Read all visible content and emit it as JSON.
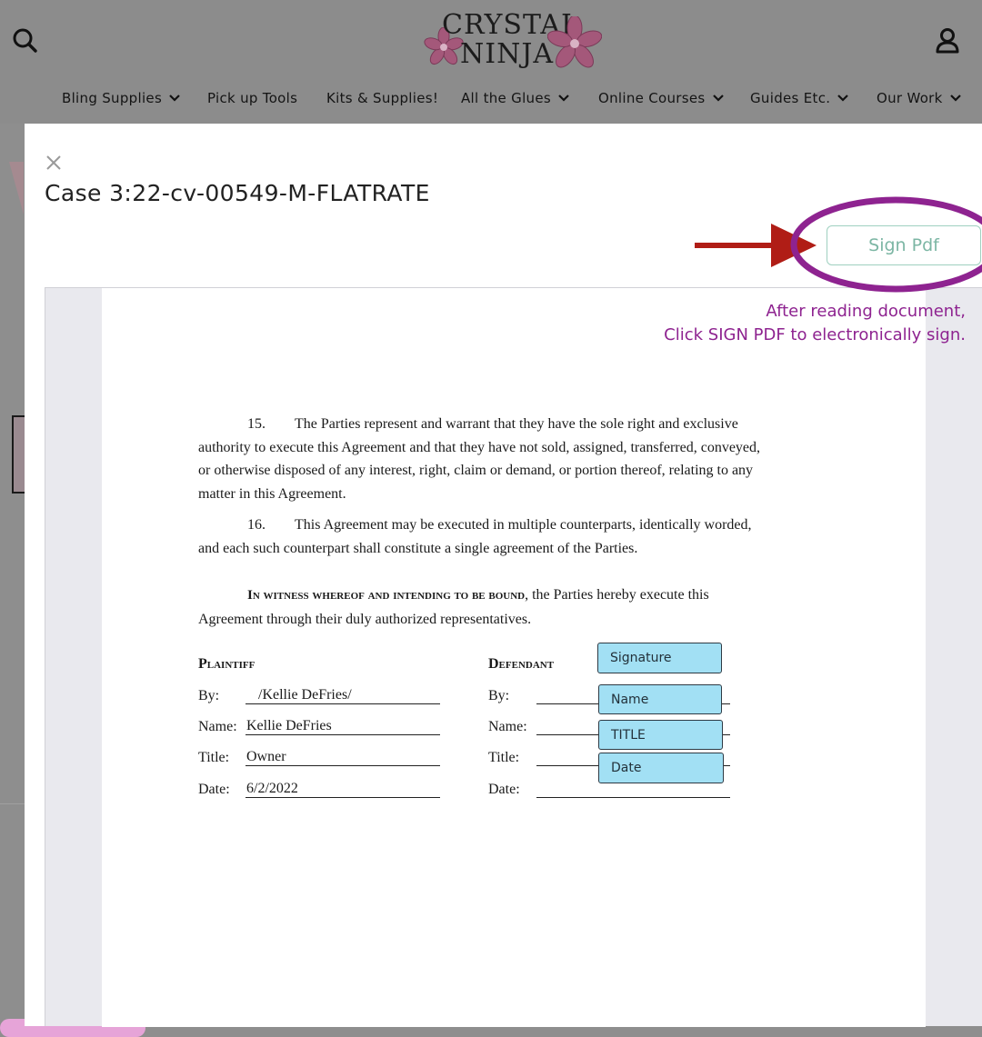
{
  "header": {
    "logo_line1": "CRYSTAL",
    "logo_line2": "NINJA",
    "nav": [
      {
        "label": "Bling Supplies",
        "has_dropdown": true
      },
      {
        "label": "Pick up Tools",
        "has_dropdown": false
      },
      {
        "label": "Kits & Supplies!",
        "has_dropdown": false
      },
      {
        "label": "All the Glues",
        "has_dropdown": true
      },
      {
        "label": "Online Courses",
        "has_dropdown": true
      },
      {
        "label": "Guides Etc.",
        "has_dropdown": true
      },
      {
        "label": "Our Work",
        "has_dropdown": true
      }
    ],
    "icons": {
      "search": "search-icon",
      "account": "account-icon",
      "dropdown": "chevron-down-icon"
    }
  },
  "modal": {
    "title": "Case 3:22-cv-00549-M-FLATRATE",
    "sign_button": "Sign Pdf",
    "close_icon": "close-icon"
  },
  "annotation": {
    "line1": "After reading document,",
    "line2": "Click SIGN PDF to electronically sign.",
    "color": "#8e2390",
    "arrow_color": "#b01d16"
  },
  "document": {
    "p15_num": "15.",
    "p15_lines": [
      "The Parties represent and warrant that they have the sole right and exclusive",
      "authority to execute this Agreement and that they have not sold, assigned, transferred, conveyed,",
      "or otherwise disposed of any interest, right, claim or demand, or portion thereof, relating to any",
      "matter in this Agreement."
    ],
    "p16_num": "16.",
    "p16_lines": [
      "This Agreement may be executed in multiple counterparts, identically worded,",
      "and each such counterpart shall constitute a single agreement of the Parties."
    ],
    "witness_bold": "In witness whereof and intending to be bound",
    "witness_rest": ", the Parties hereby execute this",
    "witness_line2": "Agreement through their duly authorized representatives.",
    "plaintiff": {
      "heading": "Plaintiff",
      "by_label": "By:",
      "by_value": "/Kellie DeFries/",
      "name_label": "Name:",
      "name_value": "Kellie DeFries",
      "title_label": "Title:",
      "title_value": "Owner",
      "date_label": "Date:",
      "date_value": "6/2/2022"
    },
    "defendant": {
      "heading": "Defendant",
      "by_label": "By:",
      "name_label": "Name:",
      "title_label": "Title:",
      "date_label": "Date:"
    },
    "fields": {
      "signature": "Signature",
      "name": "Name",
      "title": "TITLE",
      "date": "Date"
    }
  }
}
